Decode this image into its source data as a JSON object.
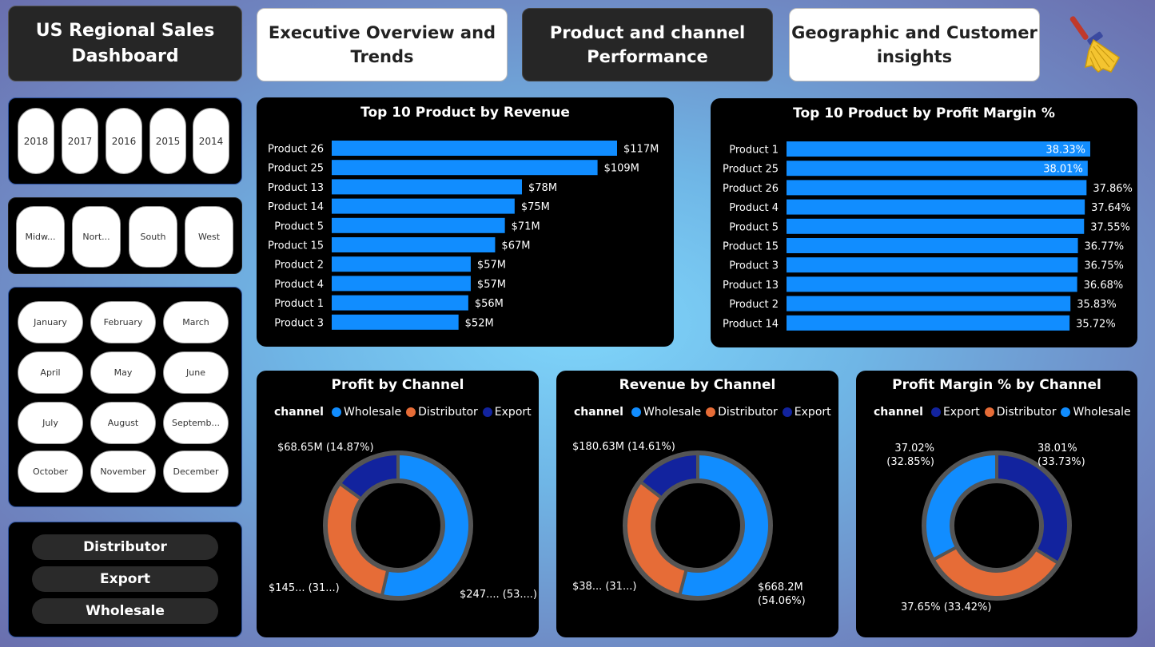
{
  "header": {
    "title_line1": "US Regional Sales",
    "title_line2": "Dashboard",
    "nav": [
      {
        "line1": "Executive Overview and",
        "line2": "Trends"
      },
      {
        "line1": "Product and channel",
        "line2": "Performance"
      },
      {
        "line1": "Geographic and Customer",
        "line2": "insights"
      }
    ],
    "clear_icon": "broom-icon"
  },
  "slicers": {
    "years": [
      "2018",
      "2017",
      "2016",
      "2015",
      "2014"
    ],
    "regions": [
      "Midw...",
      "Nort...",
      "South",
      "West"
    ],
    "months": [
      "January",
      "February",
      "March",
      "April",
      "May",
      "June",
      "July",
      "August",
      "Septemb...",
      "October",
      "November",
      "December"
    ],
    "channels": [
      "Distributor",
      "Export",
      "Wholesale"
    ]
  },
  "colors": {
    "bar": "#118dff",
    "wholesale": "#118dff",
    "distributor": "#e66c37",
    "export": "#12239e"
  },
  "chart_data": [
    {
      "type": "bar",
      "orientation": "horizontal",
      "title": "Top 10 Product by Revenue",
      "categories": [
        "Product 26",
        "Product 25",
        "Product 13",
        "Product 14",
        "Product 5",
        "Product 15",
        "Product 2",
        "Product 4",
        "Product 1",
        "Product 3"
      ],
      "values": [
        117,
        109,
        78,
        75,
        71,
        67,
        57,
        57,
        56,
        52
      ],
      "labels": [
        "$117M",
        "$109M",
        "$78M",
        "$75M",
        "$71M",
        "$67M",
        "$57M",
        "$57M",
        "$56M",
        "$52M"
      ],
      "unit": "$M",
      "xlim": [
        0,
        117
      ]
    },
    {
      "type": "bar",
      "orientation": "horizontal",
      "title": "Top 10 Product by Profit Margin %",
      "categories": [
        "Product 1",
        "Product 25",
        "Product 26",
        "Product 4",
        "Product 5",
        "Product 15",
        "Product 3",
        "Product 13",
        "Product 2",
        "Product 14"
      ],
      "values": [
        38.33,
        38.01,
        37.86,
        37.64,
        37.55,
        36.77,
        36.75,
        36.68,
        35.83,
        35.72
      ],
      "labels": [
        "38.33%",
        "38.01%",
        "37.86%",
        "37.64%",
        "37.55%",
        "36.77%",
        "36.75%",
        "36.68%",
        "35.83%",
        "35.72%"
      ],
      "unit": "%",
      "xlim": [
        0,
        38.33
      ]
    },
    {
      "type": "pie",
      "variant": "donut",
      "title": "Profit by Channel",
      "legend_title": "channel",
      "legend_order": [
        "Wholesale",
        "Distributor",
        "Export"
      ],
      "slices": [
        {
          "name": "Wholesale",
          "share": 53.0,
          "label": "$247.... (53....)"
        },
        {
          "name": "Distributor",
          "share": 31.0,
          "label": "$145... (31...)"
        },
        {
          "name": "Export",
          "share": 14.87,
          "label": "$68.65M (14.87%)"
        }
      ]
    },
    {
      "type": "pie",
      "variant": "donut",
      "title": "Revenue by Channel",
      "legend_title": "channel",
      "legend_order": [
        "Wholesale",
        "Distributor",
        "Export"
      ],
      "slices": [
        {
          "name": "Wholesale",
          "share": 54.06,
          "label": "$668.2M (54.06%)"
        },
        {
          "name": "Distributor",
          "share": 31.33,
          "label": "$38... (31...)"
        },
        {
          "name": "Export",
          "share": 14.61,
          "label": "$180.63M (14.61%)"
        }
      ]
    },
    {
      "type": "pie",
      "variant": "donut",
      "title": "Profit Margin % by Channel",
      "legend_title": "channel",
      "legend_order": [
        "Export",
        "Distributor",
        "Wholesale"
      ],
      "slices": [
        {
          "name": "Export",
          "share": 33.73,
          "label": "38.01% (33.73%)"
        },
        {
          "name": "Distributor",
          "share": 33.42,
          "label": "37.65% (33.42%)"
        },
        {
          "name": "Wholesale",
          "share": 32.85,
          "label": "37.02% (32.85%)"
        }
      ]
    }
  ]
}
